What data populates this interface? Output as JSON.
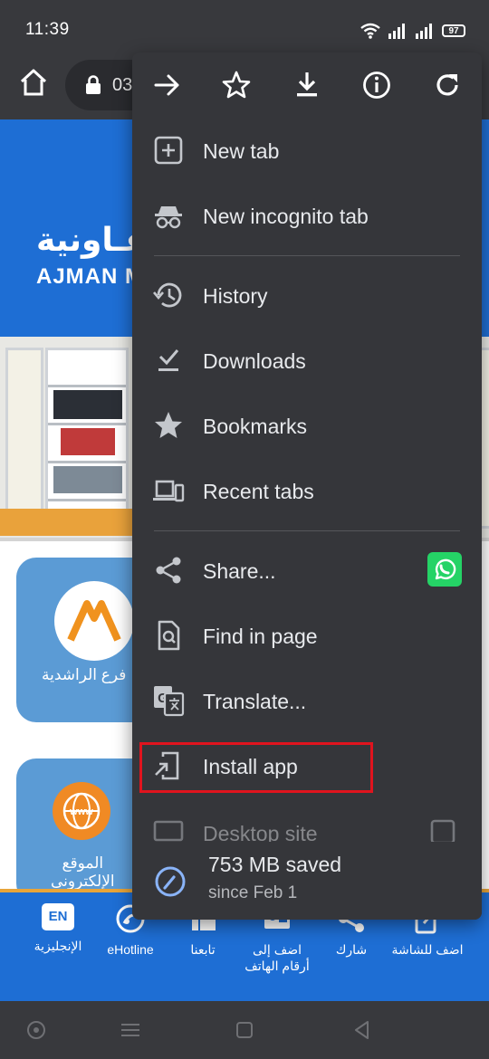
{
  "status_bar": {
    "time": "11:39",
    "battery": "97"
  },
  "toolbar": {
    "url_text": "03"
  },
  "page": {
    "banner_arabic": "عـاونية",
    "banner_latin": "AJMAN M",
    "tiles": [
      {
        "label": "فرع الراشدية"
      },
      {
        "label": "الموقع\nالإلكتروني"
      }
    ],
    "bottom_items": [
      {
        "label": "اضف للشاشة"
      },
      {
        "label": "شارك"
      },
      {
        "label": "اضف إلى\nأرقام الهاتف"
      },
      {
        "label": "تابعنا"
      },
      {
        "label": "eHotline"
      },
      {
        "label": "الإنجليزية",
        "badge": "EN"
      }
    ]
  },
  "menu": {
    "top_actions": [
      {
        "icon": "forward-icon"
      },
      {
        "icon": "star-icon"
      },
      {
        "icon": "download-icon"
      },
      {
        "icon": "info-icon"
      },
      {
        "icon": "refresh-icon"
      }
    ],
    "items": [
      {
        "label": "New tab",
        "icon": "plus-box-icon"
      },
      {
        "label": "New incognito tab",
        "icon": "incognito-icon"
      },
      {
        "label": "History",
        "icon": "history-icon"
      },
      {
        "label": "Downloads",
        "icon": "downloads-icon"
      },
      {
        "label": "Bookmarks",
        "icon": "bookmark-star-icon"
      },
      {
        "label": "Recent tabs",
        "icon": "devices-icon"
      },
      {
        "label": "Share...",
        "icon": "share-icon"
      },
      {
        "label": "Find in page",
        "icon": "find-icon"
      },
      {
        "label": "Translate...",
        "icon": "translate-icon"
      },
      {
        "label": "Install app",
        "icon": "install-app-icon",
        "highlighted": true
      },
      {
        "label": "Desktop site",
        "icon": "desktop-icon"
      }
    ],
    "savings": {
      "title": "753 MB saved",
      "subtitle": "since Feb 1"
    }
  },
  "colors": {
    "menu_bg": "#35363a",
    "system_bar": "#38393d",
    "banner_blue": "#1e6ed4",
    "highlight_red": "#e0141e",
    "whatsapp_green": "#25d366"
  }
}
